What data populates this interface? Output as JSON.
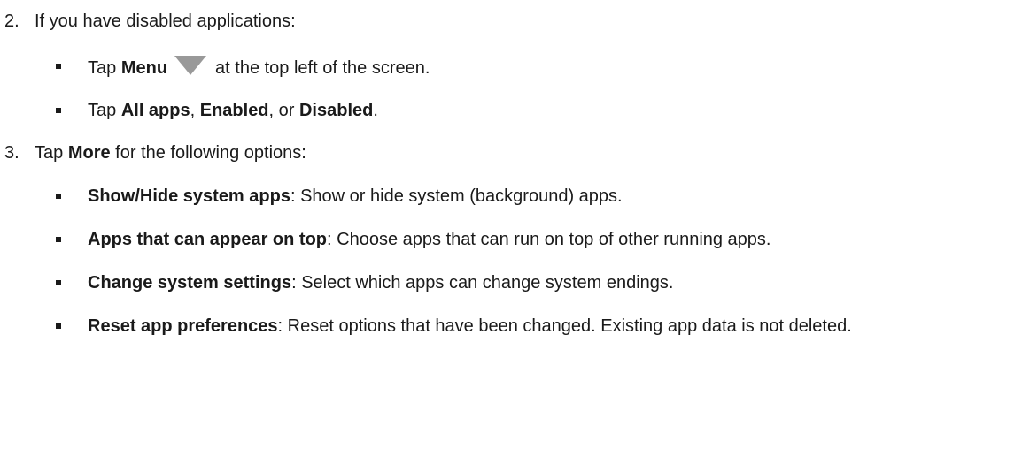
{
  "step2": {
    "number": "2.",
    "text": "If you have disabled applications:"
  },
  "step2_bullets": {
    "b1": {
      "pre": "Tap ",
      "bold": "Menu",
      "icon": "menu-triangle-icon",
      "post": "at the top left of the screen."
    },
    "b2": {
      "pre": "Tap ",
      "bold1": "All apps",
      "sep1": ", ",
      "bold2": "Enabled",
      "sep2": ", or ",
      "bold3": "Disabled",
      "post": "."
    }
  },
  "step3": {
    "number": "3.",
    "pre": "Tap ",
    "bold": "More",
    "post": " for the following options:"
  },
  "step3_bullets": [
    {
      "bold": "Show/Hide system apps",
      "rest": ": Show or hide system (background) apps."
    },
    {
      "bold": "Apps that can appear on top",
      "rest": ": Choose apps that can run on top of other running apps."
    },
    {
      "bold": "Change system settings",
      "rest": ": Select which apps can change system endings."
    },
    {
      "bold": "Reset app preferences",
      "rest": ": Reset options that have been changed. Existing app data is not deleted."
    }
  ],
  "colors": {
    "text": "#1a1a1a",
    "menu_icon": "#999999"
  }
}
